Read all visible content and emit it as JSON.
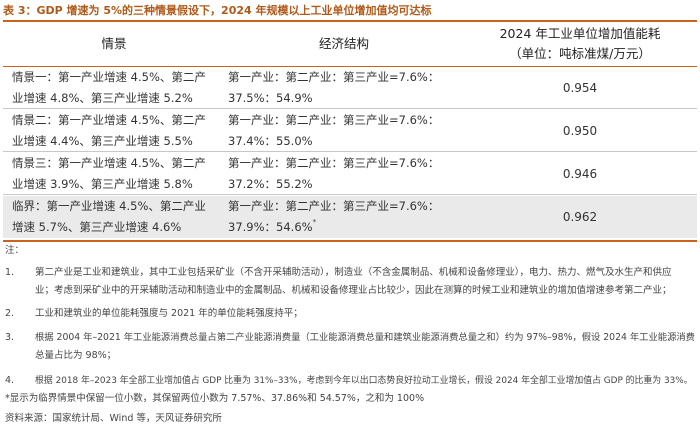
{
  "title": "表 3：GDP 增速为 5%的三种情景假设下，2024 年规模以上工业单位增加值均可达标",
  "table": {
    "headers": {
      "scenario": "情景",
      "structure": "经济结构",
      "energy_line1": "2024 年工业单位增加值能耗",
      "energy_line2": "（单位：吨标准煤/万元）"
    },
    "rows": [
      {
        "scenario_line1": "情景一：第一产业增速 4.5%、第二产",
        "scenario_line2": "业增速 4.8%、第三产业增速 5.2%",
        "structure_line1": "第一产业：第二产业：第三产业=7.6%：",
        "structure_line2": "37.5%：54.9%",
        "structure_mark": "",
        "energy": "0.954",
        "shaded": false
      },
      {
        "scenario_line1": "情景二：第一产业增速 4.5%、第二产",
        "scenario_line2": "业增速 4.4%、第三产业增速 5.5%",
        "structure_line1": "第一产业：第二产业：第三产业=7.6%：",
        "structure_line2": "37.4%：55.0%",
        "structure_mark": "",
        "energy": "0.950",
        "shaded": false
      },
      {
        "scenario_line1": "情景三：第一产业增速 4.5%、第二产",
        "scenario_line2": "业增速 3.9%、第三产业增速 5.8%",
        "structure_line1": "第一产业：第二产业：第三产业=7.6%：",
        "structure_line2": "37.2%：55.2%",
        "structure_mark": "",
        "energy": "0.946",
        "shaded": false
      },
      {
        "scenario_line1": "临界：第一产业增速 4.5%、第二产业",
        "scenario_line2": "增速 5.7%、第三产业增速 4.6%",
        "structure_line1": "第一产业：第二产业：第三产业=7.6%：",
        "structure_line2": "37.9%：54.6%",
        "structure_mark": "*",
        "energy": "0.962",
        "shaded": true
      }
    ]
  },
  "notes": {
    "heading": "注：",
    "items": [
      {
        "num": "1.",
        "line1": "第二产业是工业和建筑业，其中工业包括采矿业（不含开采辅助活动），制造业（不含金属制品、机械和设备修理业），电力、热力、燃气及水生产和供应",
        "line2": "业；考虑到采矿业中的开采辅助活动和制造业中的金属制品、机械和设备修理业占比较少，因此在测算的时候工业和建筑业的增加值增速参考第二产业；"
      },
      {
        "num": "2.",
        "line1": "工业和建筑业的单位能耗强度与 2021 年的单位能耗强度持平；",
        "line2": ""
      },
      {
        "num": "3.",
        "line1": "根据 2004 年–2021 年工业能源消费总量占第二产业能源消费量（工业能源消费总量和建筑业能源消费总量之和）约为 97%–98%，假设 2024 年工业能源消费",
        "line2": "总量占比为 98%；"
      },
      {
        "num": "4.",
        "line1": "根据 2018 年–2023 年全部工业增加值占 GDP 比重为 31%–33%，考虑到今年以出口态势良好拉动工业增长，假设 2024 年全部工业增加值占 GDP 的比重为 33%。",
        "line2": ""
      }
    ],
    "star_note": "*显示为临界情景中保留一位小数，其保留两位小数为 7.57%、37.86%和 54.57%，之和为 100%",
    "source": "资料来源：国家统计局、Wind 等，天风证券研究所"
  },
  "colors": {
    "accent": "#c9641e",
    "title_text": "#b05a1a",
    "shaded_row": "#eaeaea"
  }
}
